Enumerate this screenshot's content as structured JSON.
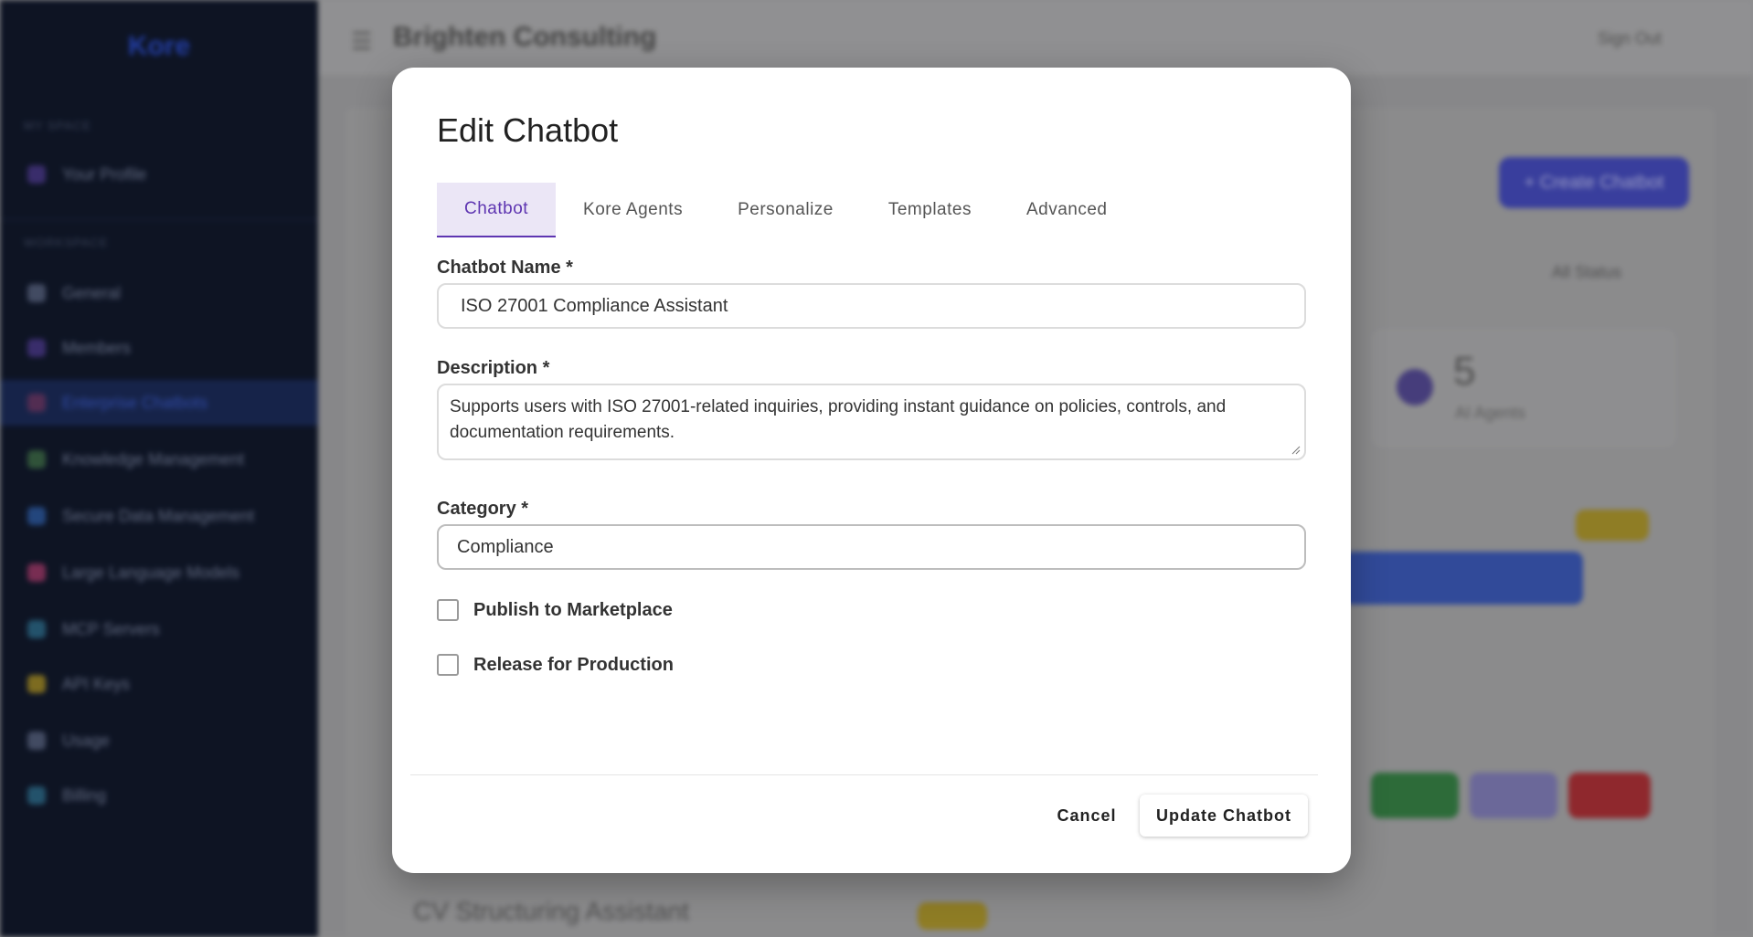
{
  "background": {
    "sidebar": {
      "logo": "Kore",
      "section_primary": "MY SPACE",
      "section_secondary": "WORKSPACE",
      "items": [
        {
          "label": "Your Profile",
          "icon": "profile-icon",
          "color": "#4a3a8a"
        },
        {
          "label": "General",
          "icon": "settings-icon",
          "color": "#55607e"
        },
        {
          "label": "Members",
          "icon": "members-icon",
          "color": "#4a3a8a"
        },
        {
          "label": "Enterprise Chatbots",
          "icon": "chatbot-icon",
          "color": "#6a3a6a",
          "active": true
        },
        {
          "label": "Knowledge Management",
          "icon": "knowledge-icon",
          "color": "#3e6a4a"
        },
        {
          "label": "Secure Data Management",
          "icon": "secure-data-icon",
          "color": "#2e5aa0"
        },
        {
          "label": "Large Language Models",
          "icon": "llm-icon",
          "color": "#9a3a6a"
        },
        {
          "label": "MCP Servers",
          "icon": "server-icon",
          "color": "#2e6a8a"
        },
        {
          "label": "API Keys",
          "icon": "key-icon",
          "color": "#a08a2a"
        },
        {
          "label": "Usage",
          "icon": "usage-icon",
          "color": "#55607e"
        },
        {
          "label": "Billing",
          "icon": "billing-icon",
          "color": "#2e6a8a"
        }
      ]
    },
    "topbar": {
      "company": "Brighten Consulting",
      "signout": "Sign Out"
    },
    "create_button": "+ Create Chatbot",
    "status_filter": "All Status",
    "stat": {
      "value": "5",
      "label": "AI Agents"
    },
    "second_title": "CV Structuring Assistant"
  },
  "modal": {
    "title": "Edit Chatbot",
    "tabs": [
      {
        "label": "Chatbot",
        "active": true
      },
      {
        "label": "Kore Agents"
      },
      {
        "label": "Personalize"
      },
      {
        "label": "Templates"
      },
      {
        "label": "Advanced"
      }
    ],
    "fields": {
      "name_label": "Chatbot Name *",
      "name_value": "ISO 27001 Compliance Assistant",
      "description_label": "Description *",
      "description_value": "Supports users with ISO 27001-related inquiries, providing instant guidance on policies, controls, and documentation requirements.",
      "category_label": "Category *",
      "category_value": "Compliance"
    },
    "checkboxes": {
      "publish_label": "Publish to Marketplace",
      "publish_checked": false,
      "release_label": "Release for Production",
      "release_checked": false
    },
    "buttons": {
      "cancel": "Cancel",
      "update": "Update Chatbot"
    }
  },
  "colors": {
    "accent": "#5e35b1",
    "tab_active_bg": "#ebe6f6",
    "sidebar_bg": "#121a2e"
  }
}
